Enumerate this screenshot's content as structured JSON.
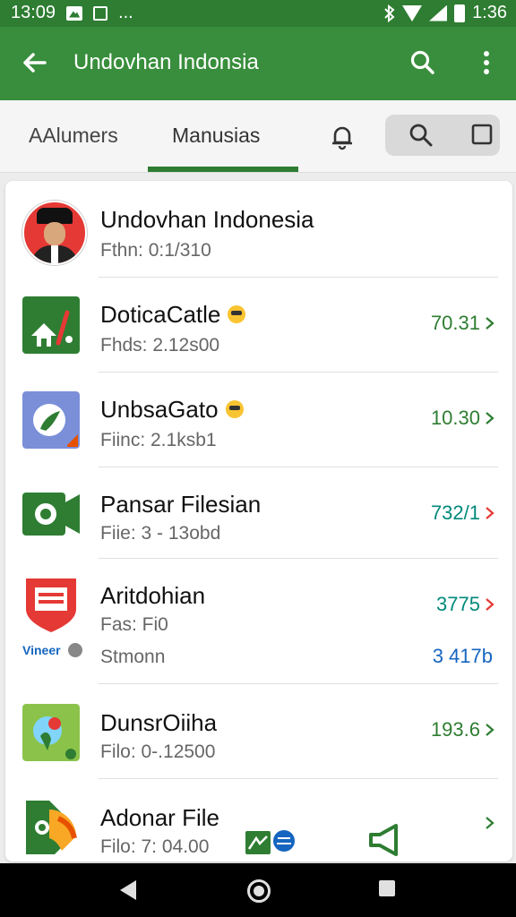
{
  "status_bar": {
    "time_left": "13:09",
    "time_right": "1:36",
    "dots": "..."
  },
  "app_bar": {
    "title": "Undovhan Indonsia"
  },
  "tabs": {
    "tab1": "AAlumers",
    "tab2": "Manusias"
  },
  "rows": [
    {
      "title": "Undovhan Indonesia",
      "subtitle": "Fthn: 0:1/310",
      "value": ""
    },
    {
      "title": "DoticaCatle",
      "subtitle": "Fhds: 2.12s00",
      "value": "70.31",
      "value_color": "#2e7d32",
      "chevron_color": "#2e7d32"
    },
    {
      "title": "UnbsaGato",
      "subtitle": "Fiinc: 2.1ksb1",
      "value": "10.30",
      "value_color": "#2e7d32",
      "chevron_color": "#2e7d32"
    },
    {
      "title": "Pansar Filesian",
      "subtitle": "Fiie: 3 - 13obd",
      "value": "732/1",
      "value_color": "#00897b",
      "chevron_color": "#e53935"
    },
    {
      "title": "Aritdohian",
      "subtitle": "Fas: Fi0",
      "value": "3775",
      "value_color": "#00897b",
      "chevron_color": "#e53935",
      "extra_label": "Vineer",
      "extra_sub": "Stmonn",
      "extra_value": "3 417b"
    },
    {
      "title": "DunsrOiiha",
      "subtitle": "Filo: 0-.12500",
      "value": "193.6",
      "value_color": "#2e7d32",
      "chevron_color": "#2e7d32"
    },
    {
      "title": "Adonar File",
      "subtitle": "Filo: 7: 04.00",
      "value": "",
      "chevron_color": "#2e7d32"
    }
  ],
  "colors": {
    "primary": "#388e3c",
    "status": "#2e7d32",
    "accent_red": "#e53935"
  }
}
